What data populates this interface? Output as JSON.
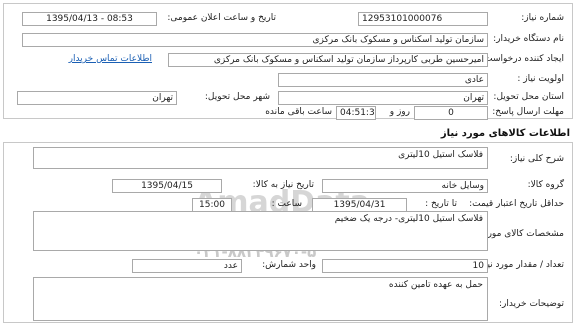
{
  "header": {
    "need_number_label": "شماره نیاز:",
    "need_number": "12953101000076",
    "announce_label": "تاریخ و ساعت اعلان عمومی:",
    "announce_value": "1395/04/13 - 08:53",
    "buyer_org_label": "نام دستگاه خریدار:",
    "buyer_org": "سازمان تولید اسکناس و مسکوک بانک مرکزی",
    "requester_label": "ایجاد کننده درخواست:",
    "requester": "امیرحسین طربی کارپرداز سازمان تولید اسکناس و مسکوک بانک مرکزی",
    "contact_link": "اطلاعات تماس خریدار",
    "priority_label": "اولویت نیاز :",
    "priority": "عادی",
    "province_label": "استان محل تحویل:",
    "province": "تهران",
    "city_label": "شهر محل تحویل:",
    "city": "تهران",
    "deadline_label": "مهلت ارسال پاسخ:",
    "deadline_days": "0",
    "days_word": "روز و",
    "deadline_time": "04:51:36",
    "remaining_label": "ساعت باقی مانده"
  },
  "goods": {
    "section_title": "اطلاعات کالاهای مورد نیاز",
    "summary_label": "شرح کلی نیاز:",
    "summary": "فلاسک استیل 10لیتری",
    "group_label": "گروه کالا:",
    "group": "وسایل خانه",
    "need_date_label": "تاریخ نیاز به کالا:",
    "need_date": "1395/04/15",
    "min_validity_label": "حداقل تاریخ اعتبار قیمت:",
    "to_date_label": "تا تاریخ :",
    "to_date": "1395/04/31",
    "hour_label": "ساعت :",
    "hour": "15:00",
    "spec_label": "مشخصات کالای مورد نیاز:",
    "spec": "فلاسک استیل 10لیتری- درجه یک ضخیم",
    "qty_label": "تعداد / مقدار مورد نیاز:",
    "qty": "10",
    "unit_label": "واحد شمارش:",
    "unit": "عدد",
    "buyer_notes_label": "توضیحات خریدار:",
    "buyer_notes": "حمل به عهده تامین کننده"
  },
  "watermark": {
    "brand": "AmadData",
    "line1": "پایگاه اطلاع رسانی مناقصه و مزایده",
    "line2": "۰۲۱-۸۸۳۴۹۶۷۰-۵"
  }
}
